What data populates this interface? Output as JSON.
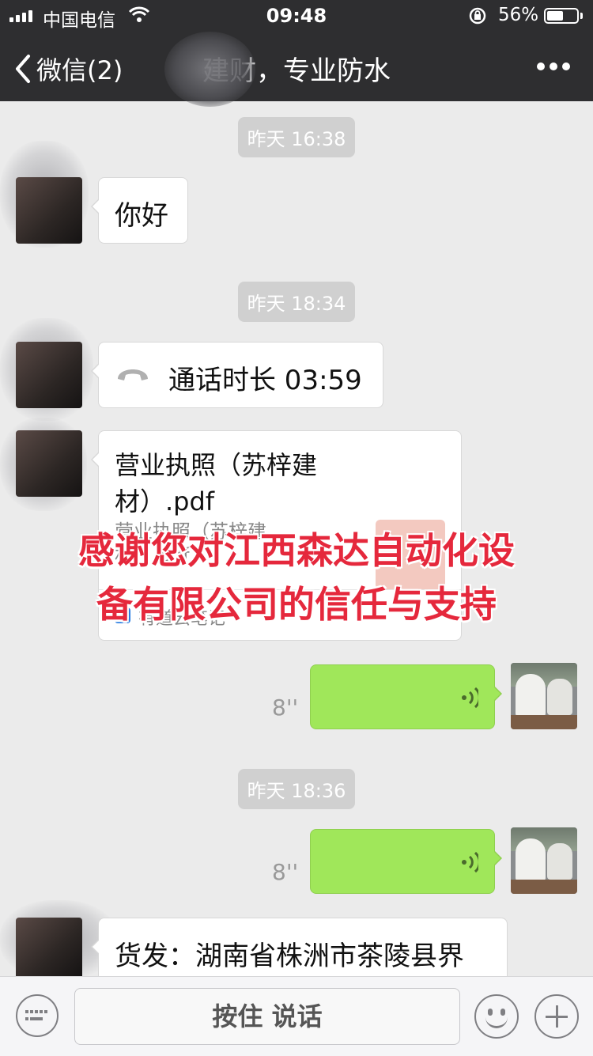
{
  "status_bar": {
    "carrier": "中国电信",
    "time": "09:48",
    "battery_percent": "56%",
    "battery_level": 0.56
  },
  "nav": {
    "back_label": "微信(2)",
    "title": "建财，专业防水",
    "more_icon": "more-dots-icon"
  },
  "chat": {
    "timestamps": [
      "昨天 16:38",
      "昨天 18:34",
      "昨天 18:36"
    ],
    "msg_hello": "你好",
    "call": {
      "label": "通话时长 03:59",
      "icon": "phone-hangup-icon"
    },
    "file": {
      "title": "营业执照（苏梓建材）.pdf",
      "subtitle": "营业执照（苏梓建材）.pdf",
      "source": "有道云笔记"
    },
    "voice": [
      {
        "duration": "8''"
      },
      {
        "duration": "8''"
      }
    ],
    "address_text": "货发：湖南省株洲市茶陵县界"
  },
  "overlay": {
    "line1": "感谢您对江西森达自动化设",
    "line2": "备有限公司的信任与支持",
    "color": "#e5283c"
  },
  "input_bar": {
    "hold_to_talk": "按住 说话"
  },
  "colors": {
    "nav_bg": "#2e2e30",
    "chat_bg": "#ebebeb",
    "green_bubble": "#a0e75a"
  }
}
